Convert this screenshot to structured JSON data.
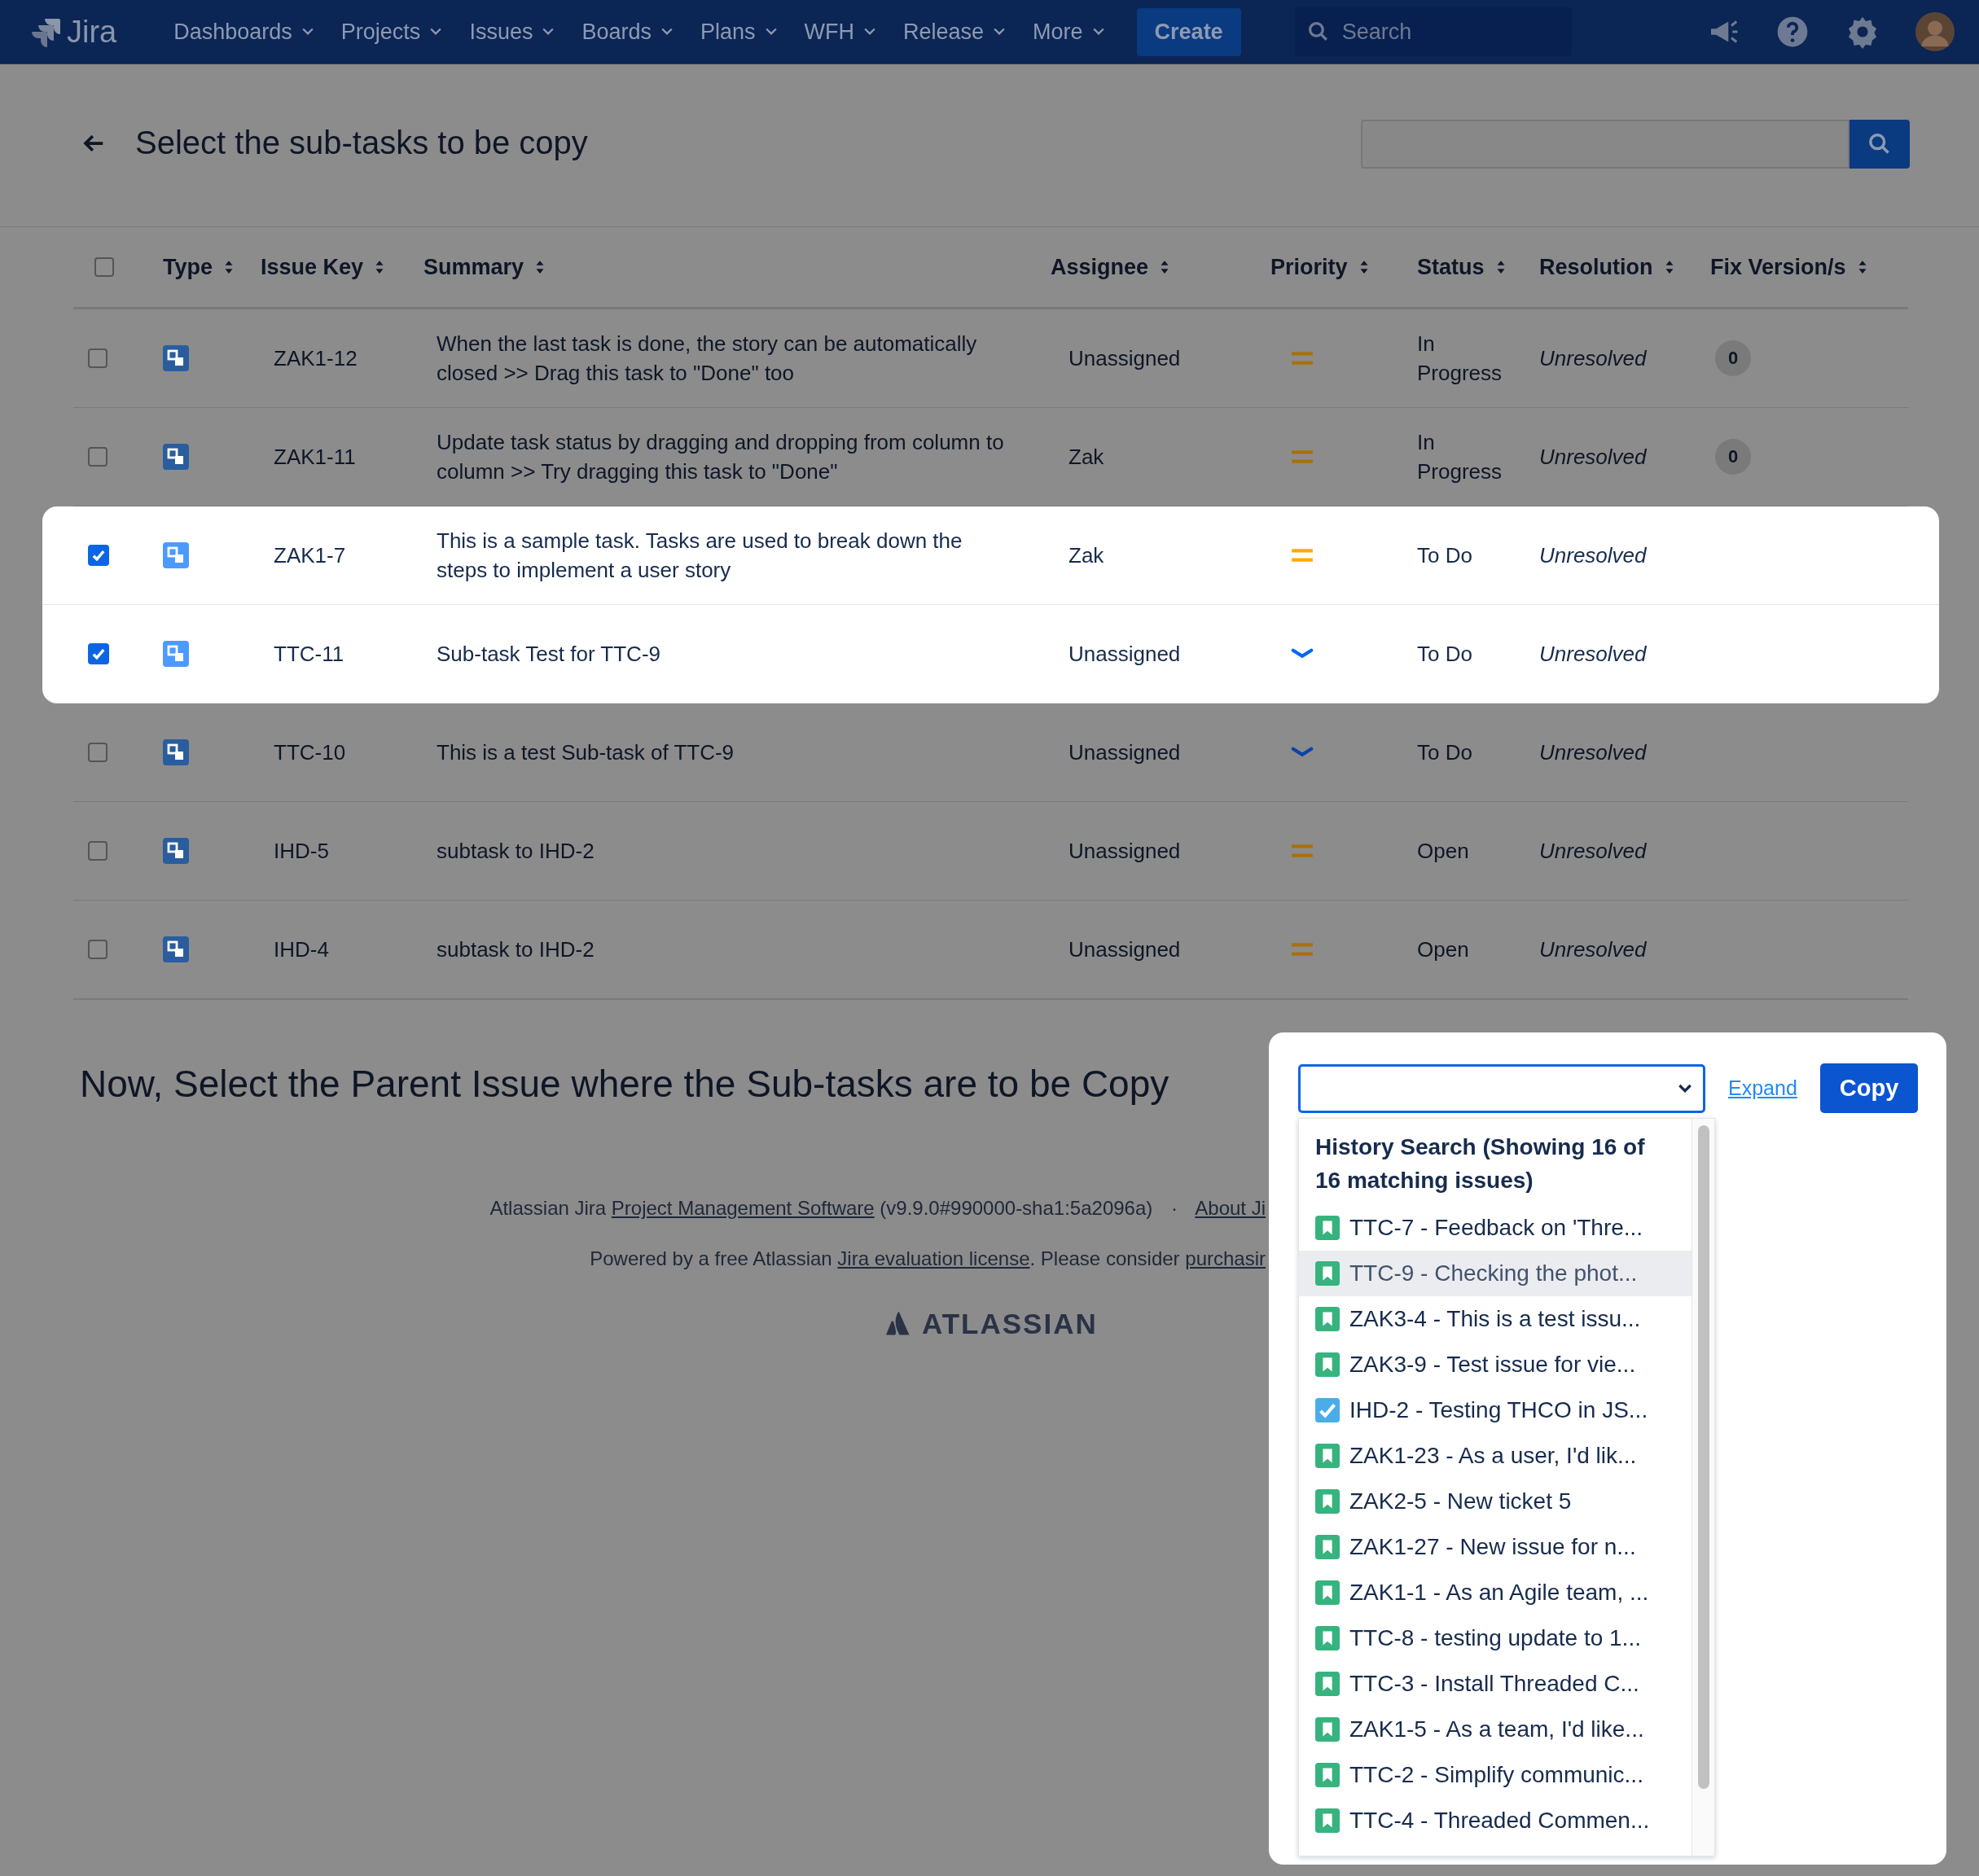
{
  "nav": {
    "logo": "Jira",
    "items": [
      "Dashboards",
      "Projects",
      "Issues",
      "Boards",
      "Plans",
      "WFH",
      "Release",
      "More"
    ],
    "create": "Create",
    "search": {
      "placeholder": "Search"
    }
  },
  "page": {
    "title": "Select the sub-tasks to be copy"
  },
  "table": {
    "columns": [
      "Type",
      "Issue Key",
      "Summary",
      "Assignee",
      "Priority",
      "Status",
      "Resolution",
      "Fix Version/s"
    ],
    "select_all": {
      "checked": false
    },
    "rows": [
      {
        "checked": false,
        "key": "ZAK1-12",
        "summary": "When the last task is done, the story can be automatically closed >> Drag this task to \"Done\" too",
        "assignee": "Unassigned",
        "priority": {
          "kind": "medium"
        },
        "status": "In Progress",
        "resolution": "Unresolved",
        "fix_version": "0"
      },
      {
        "checked": false,
        "key": "ZAK1-11",
        "summary": "Update task status by dragging and dropping from column to column >> Try dragging this task to \"Done\"",
        "assignee": "Zak",
        "priority": {
          "kind": "medium"
        },
        "status": "In Progress",
        "resolution": "Unresolved",
        "fix_version": "0"
      },
      {
        "checked": true,
        "key": "ZAK1-7",
        "summary": "This is a sample task. Tasks are used to break down the steps to implement a user story",
        "assignee": "Zak",
        "priority": {
          "kind": "medium"
        },
        "status": "To Do",
        "resolution": "Unresolved"
      },
      {
        "checked": true,
        "key": "TTC-11",
        "summary": "Sub-task Test for TTC-9",
        "assignee": "Unassigned",
        "priority": {
          "kind": "low"
        },
        "status": "To Do",
        "resolution": "Unresolved"
      },
      {
        "checked": false,
        "key": "TTC-10",
        "summary": "This is a test Sub-task of TTC-9",
        "assignee": "Unassigned",
        "priority": {
          "kind": "low"
        },
        "status": "To Do",
        "resolution": "Unresolved"
      },
      {
        "checked": false,
        "key": "IHD-5",
        "summary": "subtask to IHD-2",
        "assignee": "Unassigned",
        "priority": {
          "kind": "medium"
        },
        "status": "Open",
        "resolution": "Unresolved"
      },
      {
        "checked": false,
        "key": "IHD-4",
        "summary": "subtask to IHD-2",
        "assignee": "Unassigned",
        "priority": {
          "kind": "medium"
        },
        "status": "Open",
        "resolution": "Unresolved"
      }
    ]
  },
  "parent": {
    "heading": "Now, Select the Parent Issue where the Sub-tasks are to be Copy",
    "expand": "Expand",
    "copy": "Copy",
    "dropdown": {
      "header": "History Search (Showing 16 of 16 matching issues)",
      "items": [
        {
          "kind": "story",
          "label": "TTC-7 - Feedback on 'Thre...",
          "selected": false
        },
        {
          "kind": "story",
          "label": "TTC-9 - Checking the phot...",
          "selected": true
        },
        {
          "kind": "story",
          "label": "ZAK3-4 - This is a test issu...",
          "selected": false
        },
        {
          "kind": "story",
          "label": "ZAK3-9 - Test issue for vie...",
          "selected": false
        },
        {
          "kind": "task",
          "label": "IHD-2 - Testing THCO in JS...",
          "selected": false
        },
        {
          "kind": "story",
          "label": "ZAK1-23 - As a user, I'd lik...",
          "selected": false
        },
        {
          "kind": "story",
          "label": "ZAK2-5 - New ticket 5",
          "selected": false
        },
        {
          "kind": "story",
          "label": "ZAK1-27 - New issue for n...",
          "selected": false
        },
        {
          "kind": "story",
          "label": "ZAK1-1 - As an Agile team, ...",
          "selected": false
        },
        {
          "kind": "story",
          "label": "TTC-8 - testing update to 1...",
          "selected": false
        },
        {
          "kind": "story",
          "label": "TTC-3 - Install Threaded C...",
          "selected": false
        },
        {
          "kind": "story",
          "label": "ZAK1-5 - As a team, I'd like...",
          "selected": false
        },
        {
          "kind": "story",
          "label": "TTC-2 - Simplify communic...",
          "selected": false
        },
        {
          "kind": "story",
          "label": "TTC-4 - Threaded Commen...",
          "selected": false
        }
      ]
    }
  },
  "footer": {
    "line1": {
      "prefix": "Atlassian Jira",
      "link": "Project Management Software",
      "version": "(v9.9.0#990000-sha1:5a2096a)",
      "sep": "·",
      "about": "About Ji"
    },
    "line2": {
      "prefix": "Powered by a free Atlassian",
      "link": "Jira evaluation license",
      "middle": ". Please consider",
      "link2": "purchasir"
    },
    "brand": "ATLASSIAN"
  }
}
